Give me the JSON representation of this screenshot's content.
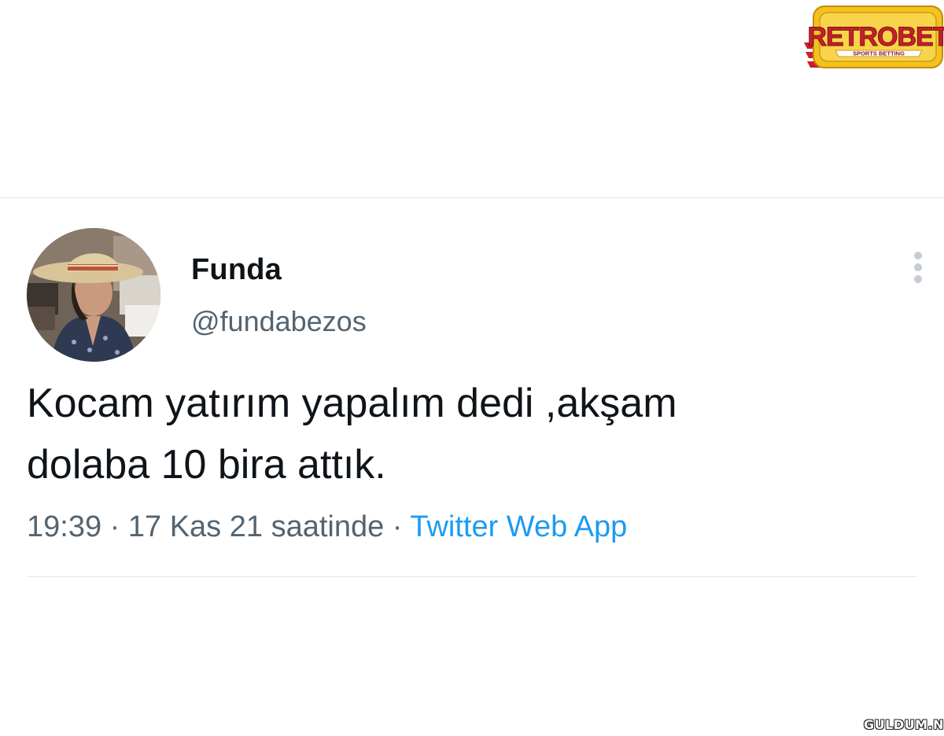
{
  "brand_logo": {
    "title": "RETROBET",
    "subtitle": "SPORTS BETTING",
    "colors": {
      "primary": "#c8202a",
      "accent": "#f4c21c"
    }
  },
  "tweet": {
    "author": {
      "display_name": "Funda",
      "handle": "@fundabezos",
      "avatar": "profile-photo"
    },
    "text_lines": [
      "Kocam yatırım yapalım dedi ,akşam",
      "dolaba 10 bira attık."
    ],
    "meta": {
      "time": "19:39",
      "separator": "·",
      "date": "17 Kas 21 saatinde",
      "source": "Twitter Web App"
    },
    "more_icon": "more-vertical-icon"
  },
  "watermark": "GULDUM.NET",
  "colors": {
    "text": "#0f1419",
    "secondary": "#536471",
    "link": "#1d9bf0",
    "divider": "#e1e5e9"
  }
}
